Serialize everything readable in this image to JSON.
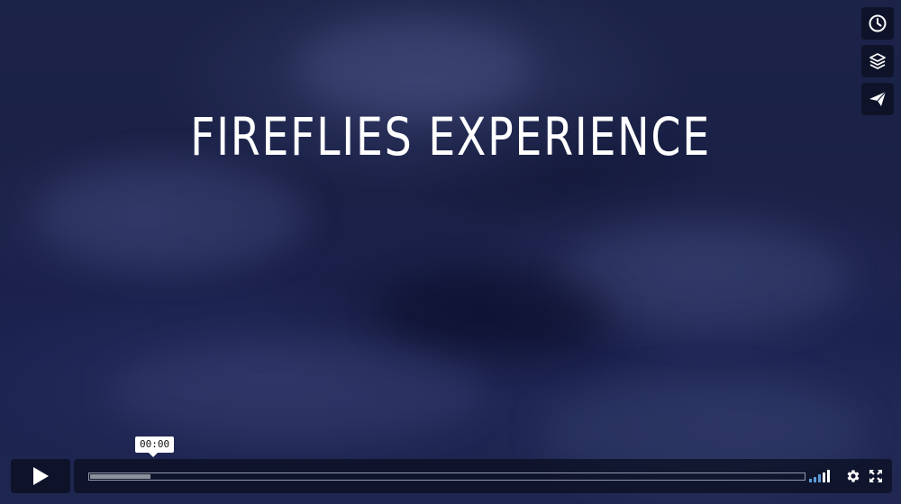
{
  "video": {
    "title": "FIREFLIES EXPERIENCE"
  },
  "side_buttons": [
    {
      "icon": "clock-icon",
      "name": "watch-later-button"
    },
    {
      "icon": "layers-icon",
      "name": "collections-button"
    },
    {
      "icon": "paper-plane-icon",
      "name": "share-button"
    }
  ],
  "controls": {
    "current_time": "00:00",
    "loaded_fraction": 0.085,
    "volume_level": 0.6,
    "accent_color": "#5a9bd8"
  }
}
